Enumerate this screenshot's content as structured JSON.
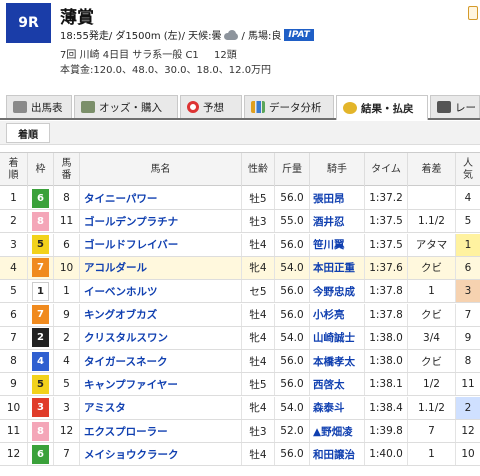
{
  "race": {
    "number": "9R",
    "name": "薄賞",
    "start": "18:55発走",
    "course": "/ ダ1500m (左)",
    "weather_label": "/ 天候:曇",
    "track_condition": "/ 馬場:良",
    "ipat_badge": "IPAT",
    "meeting": "7回 川崎 4日目 サラ系一般 C1",
    "head_count": "12頭",
    "prize": "本賞金:120.0、48.0、30.0、18.0、12.0万円"
  },
  "tabs": [
    {
      "label": "出馬表",
      "icon": "table-icon"
    },
    {
      "label": "オッズ・購入",
      "icon": "odds-icon"
    },
    {
      "label": "予想",
      "icon": "target-icon"
    },
    {
      "label": "データ分析",
      "icon": "bar-chart-icon"
    },
    {
      "label": "結果・払戻",
      "icon": "coins-icon"
    },
    {
      "label": "レー",
      "icon": "list-icon"
    }
  ],
  "subtab": "着順",
  "columns": [
    "着順",
    "枠",
    "馬番",
    "馬名",
    "性齢",
    "斤量",
    "騎手",
    "タイム",
    "着差",
    "人気"
  ],
  "frame_colors": {
    "1": "#ffffff",
    "2": "#222222",
    "3": "#e03c2a",
    "4": "#2f5fd0",
    "5": "#f2d21b",
    "6": "#3aa13a",
    "7": "#f08a1e",
    "8": "#f4a6b8"
  },
  "popularity_colors": {
    "1": "#fff2a0",
    "2": "#cfe0ff",
    "3": "#f6d2b0"
  },
  "results": [
    {
      "rank": "1",
      "frame": "6",
      "horse_no": "8",
      "horse": "タイニーパワー",
      "sex_age": "牡5",
      "weight": "56.0",
      "jockey": "張田昂",
      "time": "1:37.2",
      "margin": "",
      "pop": "4"
    },
    {
      "rank": "2",
      "frame": "8",
      "horse_no": "11",
      "horse": "ゴールデンプラチナ",
      "sex_age": "牡3",
      "weight": "55.0",
      "jockey": "酒井忍",
      "time": "1:37.5",
      "margin": "1.1/2",
      "pop": "5"
    },
    {
      "rank": "3",
      "frame": "5",
      "horse_no": "6",
      "horse": "ゴールドフレイバー",
      "sex_age": "牡4",
      "weight": "56.0",
      "jockey": "笹川翼",
      "time": "1:37.5",
      "margin": "アタマ",
      "pop": "1"
    },
    {
      "rank": "4",
      "frame": "7",
      "horse_no": "10",
      "horse": "アコルダール",
      "sex_age": "牝4",
      "weight": "54.0",
      "jockey": "本田正重",
      "time": "1:37.6",
      "margin": "クビ",
      "pop": "6"
    },
    {
      "rank": "5",
      "frame": "1",
      "horse_no": "1",
      "horse": "イーベンホルツ",
      "sex_age": "セ5",
      "weight": "56.0",
      "jockey": "今野忠成",
      "time": "1:37.8",
      "margin": "1",
      "pop": "3"
    },
    {
      "rank": "6",
      "frame": "7",
      "horse_no": "9",
      "horse": "キングオブカズ",
      "sex_age": "牡4",
      "weight": "56.0",
      "jockey": "小杉亮",
      "time": "1:37.8",
      "margin": "クビ",
      "pop": "7"
    },
    {
      "rank": "7",
      "frame": "2",
      "horse_no": "2",
      "horse": "クリスタルスワン",
      "sex_age": "牝4",
      "weight": "54.0",
      "jockey": "山崎誠士",
      "time": "1:38.0",
      "margin": "3/4",
      "pop": "9"
    },
    {
      "rank": "8",
      "frame": "4",
      "horse_no": "4",
      "horse": "タイガースネーク",
      "sex_age": "牡4",
      "weight": "56.0",
      "jockey": "本橋孝太",
      "time": "1:38.0",
      "margin": "クビ",
      "pop": "8"
    },
    {
      "rank": "9",
      "frame": "5",
      "horse_no": "5",
      "horse": "キャンプファイヤー",
      "sex_age": "牡5",
      "weight": "56.0",
      "jockey": "西啓太",
      "time": "1:38.1",
      "margin": "1/2",
      "pop": "11"
    },
    {
      "rank": "10",
      "frame": "3",
      "horse_no": "3",
      "horse": "アミスタ",
      "sex_age": "牝4",
      "weight": "54.0",
      "jockey": "森泰斗",
      "time": "1:38.4",
      "margin": "1.1/2",
      "pop": "2"
    },
    {
      "rank": "11",
      "frame": "8",
      "horse_no": "12",
      "horse": "エクスプローラー",
      "sex_age": "牡3",
      "weight": "52.0",
      "jockey": "▲野畑凌",
      "time": "1:39.8",
      "margin": "7",
      "pop": "12"
    },
    {
      "rank": "12",
      "frame": "6",
      "horse_no": "7",
      "horse": "メイショウクラーク",
      "sex_age": "牡4",
      "weight": "56.0",
      "jockey": "和田譲治",
      "time": "1:40.0",
      "margin": "1",
      "pop": "10"
    }
  ]
}
